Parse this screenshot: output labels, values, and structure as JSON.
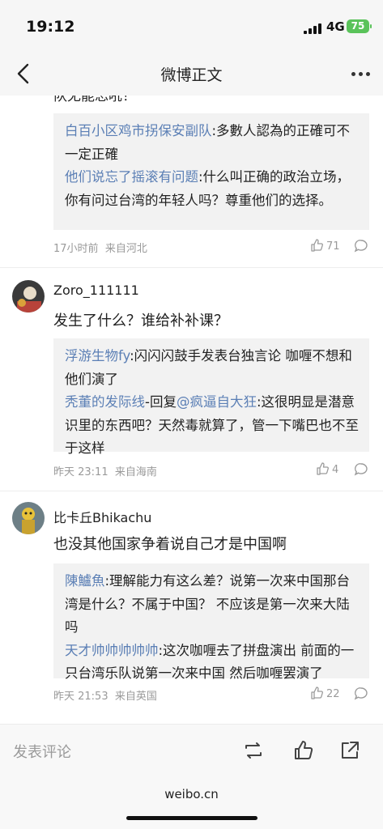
{
  "status_bar": {
    "time": "19:12",
    "network": "4G",
    "battery": "75"
  },
  "nav": {
    "title": "微博正文"
  },
  "top_cut_text": "队无能忘吼！",
  "comments": [
    {
      "replies": [
        {
          "nick": "白百小区鸡市拐保安副队",
          "text": ":多數人認為的正確可不一定正確"
        },
        {
          "nick": "他们说忘了摇滚有问题",
          "text": ":什么叫正确的政治立场，你有问过台湾的年轻人吗？尊重他们的选择。"
        }
      ],
      "time": "17小时前",
      "location": "来自河北",
      "likes": "71"
    },
    {
      "username": "Zoro_111111",
      "text": "发生了什么？谁给补补课？",
      "replies": [
        {
          "nick": "浮游生物fy",
          "text": ":闪闪闪鼓手发表台独言论 咖喱不想和他们演了"
        },
        {
          "nick": "秃董的发际线",
          "text": "-回复",
          "mention": "@疯逼自大狂",
          "text2": ":这很明显是潜意识里的东西吧？天然毒就算了，管一下嘴巴也不至于这样"
        }
      ],
      "time": "昨天 23:11",
      "location": "来自海南",
      "likes": "4"
    },
    {
      "username": "比卡丘Bhikachu",
      "text": "也没其他国家争着说自己才是中国啊",
      "replies": [
        {
          "nick": "陳鱸魚",
          "text": ":理解能力有这么差？说第一次来中国那台湾是什么？不属于中国？ 不应该是第一次来大陆吗"
        },
        {
          "nick": "天才帅帅帅帅帅",
          "text": ":这次咖喱去了拼盘演出 前面的一只台湾乐队说第一次来中国 然后咖喱罢演了"
        }
      ],
      "time": "昨天 21:53",
      "location": "来自英国",
      "likes": "22"
    }
  ],
  "bottom_bar": {
    "compose_placeholder": "发表评论"
  },
  "footer": {
    "domain": "weibo.cn"
  },
  "colors": {
    "nickname": "#5b7fb5",
    "battery": "#5ac35a",
    "quote_bg": "#f2f2f2"
  },
  "icons": [
    "back-icon",
    "more-icon",
    "like-icon",
    "reply-icon",
    "repost-icon",
    "thumb-up-icon",
    "share-icon"
  ]
}
